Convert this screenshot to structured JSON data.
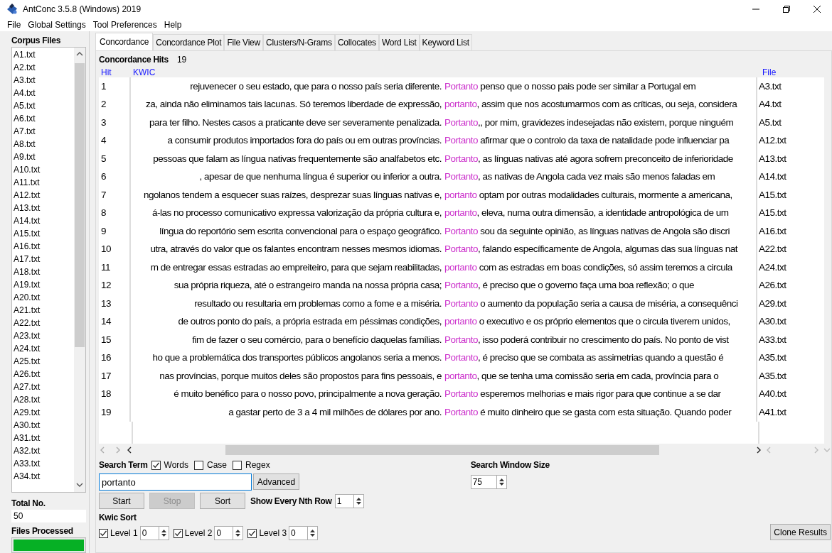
{
  "window": {
    "title": "AntConc 3.5.8 (Windows) 2019"
  },
  "menu": [
    "File",
    "Global Settings",
    "Tool Preferences",
    "Help"
  ],
  "corpus_files": {
    "label": "Corpus Files",
    "items": [
      "A1.txt",
      "A2.txt",
      "A3.txt",
      "A4.txt",
      "A5.txt",
      "A6.txt",
      "A7.txt",
      "A8.txt",
      "A9.txt",
      "A10.txt",
      "A11.txt",
      "A12.txt",
      "A13.txt",
      "A14.txt",
      "A15.txt",
      "A16.txt",
      "A17.txt",
      "A18.txt",
      "A19.txt",
      "A20.txt",
      "A21.txt",
      "A22.txt",
      "A23.txt",
      "A24.txt",
      "A25.txt",
      "A26.txt",
      "A27.txt",
      "A28.txt",
      "A29.txt",
      "A30.txt",
      "A31.txt",
      "A32.txt",
      "A33.txt",
      "A34.txt"
    ]
  },
  "total": {
    "label": "Total No.",
    "value": "50"
  },
  "files_processed": {
    "label": "Files Processed",
    "level": 1
  },
  "tabs": [
    {
      "label": "Concordance",
      "selected": true
    },
    {
      "label": "Concordance Plot",
      "selected": false
    },
    {
      "label": "File View",
      "selected": false
    },
    {
      "label": "Clusters/N-Grams",
      "selected": false
    },
    {
      "label": "Collocates",
      "selected": false
    },
    {
      "label": "Word List",
      "selected": false
    },
    {
      "label": "Keyword List",
      "selected": false
    }
  ],
  "hits": {
    "label": "Concordance Hits",
    "value": "19"
  },
  "table": {
    "columns": [
      "Hit",
      "KWIC",
      "File"
    ],
    "rows": [
      {
        "hit": "1",
        "left": "rejuvenecer o seu estado, que para o nosso país seria diferente.",
        "keyword": "Portanto",
        "right": " penso que o nosso pais pode ser similar a Portugal em",
        "file": "A3.txt"
      },
      {
        "hit": "2",
        "left": "za, ainda não eliminamos tais lacunas. Só teremos liberdade de expressão,",
        "keyword": "portanto",
        "right": ", assim que nos acostumarmos com as críticas, ou seja, considera",
        "file": "A4.txt"
      },
      {
        "hit": "3",
        "left": "para ter filho. Nestes casos a praticante deve ser severamente penalizada.",
        "keyword": "Portanto",
        "right": ",, por mim, gravidezes indesejadas não existem, porque ninguém",
        "file": "A5.txt"
      },
      {
        "hit": "4",
        "left": "a consumir produtos importados fora do país ou em outras províncias.",
        "keyword": "Portanto",
        "right": " afirmar que o controlo da taxa de natalidade pode influenciar pa",
        "file": "A12.txt"
      },
      {
        "hit": "5",
        "left": "pessoas que falam as língua nativas frequentemente são analfabetos etc.",
        "keyword": "Portanto",
        "right": ", as línguas nativas até agora sofrem preconceito de inferioridade",
        "file": "A13.txt"
      },
      {
        "hit": "6",
        "left": ", apesar de que nenhuma língua é superior ou inferior a outra.",
        "keyword": "Portanto",
        "right": ", as nativas de Angola cada vez mais são menos faladas em",
        "file": "A14.txt"
      },
      {
        "hit": "7",
        "left": "ngolanos tendem a esquecer suas raízes, desprezar suas línguas nativas e,",
        "keyword": "portanto",
        "right": " optam por outras modalidades culturais, mormente a americana,",
        "file": "A15.txt"
      },
      {
        "hit": "8",
        "left": "á-las no processo comunicativo expressa valorização da própria cultura e,",
        "keyword": "portanto",
        "right": ", eleva, numa outra dimensão, a identidade antropológica de um",
        "file": "A15.txt"
      },
      {
        "hit": "9",
        "left": "língua do reportório sem escrita convencional para o espaço geográfico.",
        "keyword": "Portanto",
        "right": " sou da seguinte opinião, as línguas nativas de Angola são discri",
        "file": "A16.txt"
      },
      {
        "hit": "10",
        "left": "utra, através do valor que os falantes encontram nesses mesmos idiomas.",
        "keyword": "Portanto",
        "right": ", falando específicamente de Angola, algumas das sua línguas nat",
        "file": "A22.txt"
      },
      {
        "hit": "11",
        "left": "m de entregar essas estradas ao empreiteiro, para que sejam reabilitadas,",
        "keyword": "portanto",
        "right": " com as estradas em boas condições, só assim teremos a circula",
        "file": "A24.txt"
      },
      {
        "hit": "12",
        "left": "sua própria riqueza, até o estrangeiro manda na nossa própria casa;",
        "keyword": "Portanto",
        "right": ", é preciso que o governo faça uma boa reflexão; o que",
        "file": "A26.txt"
      },
      {
        "hit": "13",
        "left": "resultado ou resultaria em problemas como a fome e a miséria.",
        "keyword": "Portanto",
        "right": " o aumento da população seria a causa de miséria, a consequênci",
        "file": "A29.txt"
      },
      {
        "hit": "14",
        "left": "de outros ponto do país, a própria estrada em péssimas condições,",
        "keyword": "portanto",
        "right": " o executivo e os próprio elementos que o circula tiverem unidos,",
        "file": "A30.txt"
      },
      {
        "hit": "15",
        "left": "fim de fazer o seu comércio, para o benefício daquelas famílias.",
        "keyword": "Portanto",
        "right": ", isso poderá contribuir no crescimento do país. No ponto de vist",
        "file": "A33.txt"
      },
      {
        "hit": "16",
        "left": "ho que a problemática dos transportes públicos angolanos seria a menos.",
        "keyword": "Portanto",
        "right": ", é preciso que se combata as assimetrias quando a questão é",
        "file": "A35.txt"
      },
      {
        "hit": "17",
        "left": "nas províncias, porque muitos deles são propostos para fins pessoais, e",
        "keyword": "portanto",
        "right": ", que se tenha uma comissão seria em cada, província para o",
        "file": "A35.txt"
      },
      {
        "hit": "18",
        "left": "é muito benéfico para o nosso povo, principalmente a nova geração.",
        "keyword": "Portanto",
        "right": " esperemos melhorias e mais rigor para que continue a se dar",
        "file": "A40.txt"
      },
      {
        "hit": "19",
        "left": "a gastar perto de 3 a 4 mil milhões de dólares por ano.",
        "keyword": "Portanto",
        "right": " é muito dinheiro que se gasta com esta situação. Quando poder",
        "file": "A41.txt"
      }
    ]
  },
  "search": {
    "label": "Search Term",
    "options": [
      {
        "label": "Words",
        "checked": true
      },
      {
        "label": "Case",
        "checked": false
      },
      {
        "label": "Regex",
        "checked": false
      }
    ],
    "value": "portanto",
    "advanced": "Advanced"
  },
  "window_size": {
    "label": "Search Window Size",
    "value": "75"
  },
  "buttons": [
    {
      "label": "Start",
      "disabled": false
    },
    {
      "label": "Stop",
      "disabled": true
    },
    {
      "label": "Sort",
      "disabled": false
    }
  ],
  "nth_row": {
    "label": "Show Every Nth Row",
    "value": "1"
  },
  "kwic_sort": {
    "label": "Kwic Sort",
    "levels": [
      {
        "label": "Level 1",
        "checked": true,
        "value": "0"
      },
      {
        "label": "Level 2",
        "checked": true,
        "value": "0"
      },
      {
        "label": "Level 3",
        "checked": true,
        "value": "0"
      }
    ]
  },
  "clone": "Clone Results"
}
